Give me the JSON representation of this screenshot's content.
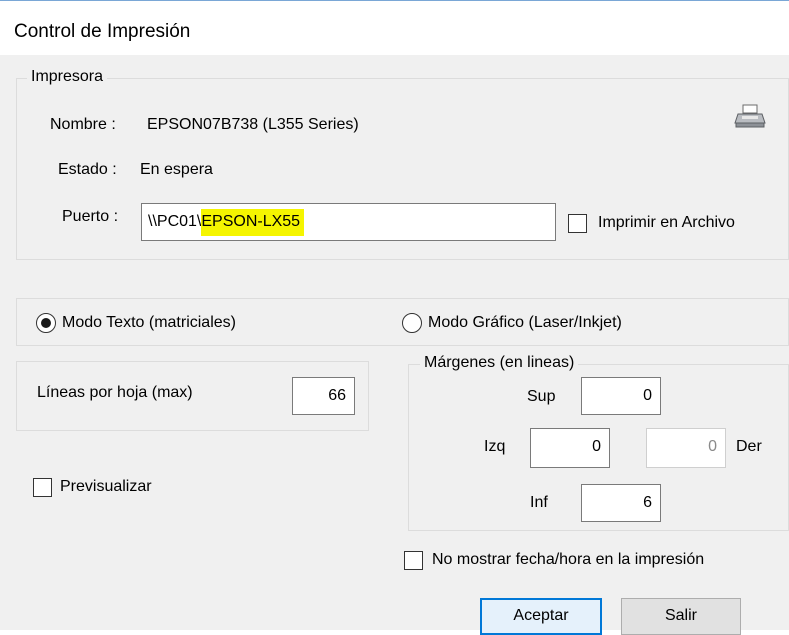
{
  "window": {
    "title": "Control de Impresión"
  },
  "printer": {
    "legend": "Impresora",
    "name_label": "Nombre :",
    "name_value": "EPSON07B738 (L355 Series)",
    "state_label": "Estado :",
    "state_value": "En espera",
    "port_label": "Puerto :",
    "port_prefix": "\\\\PC01\\",
    "port_highlight": "EPSON-LX55",
    "print_to_file_label": "Imprimir en Archivo",
    "print_to_file_checked": false,
    "icon": "printer-icon"
  },
  "mode": {
    "text_label": "Modo Texto (matriciales)",
    "graphic_label": "Modo Gráfico (Laser/Inkjet)",
    "selected": "text"
  },
  "lines": {
    "label": "Líneas por hoja (max)",
    "value": "66"
  },
  "margins": {
    "legend": "Márgenes (en lineas)",
    "sup_label": "Sup",
    "sup_value": "0",
    "izq_label": "Izq",
    "izq_value": "0",
    "der_label": "Der",
    "der_value": "0",
    "inf_label": "Inf",
    "inf_value": "6"
  },
  "preview_label": "Previsualizar",
  "no_date_label": "No mostrar fecha/hora en la impresión",
  "buttons": {
    "accept": "Aceptar",
    "exit": "Salir"
  },
  "colors": {
    "highlight": "#f5f500",
    "focus_border": "#0078d7"
  }
}
